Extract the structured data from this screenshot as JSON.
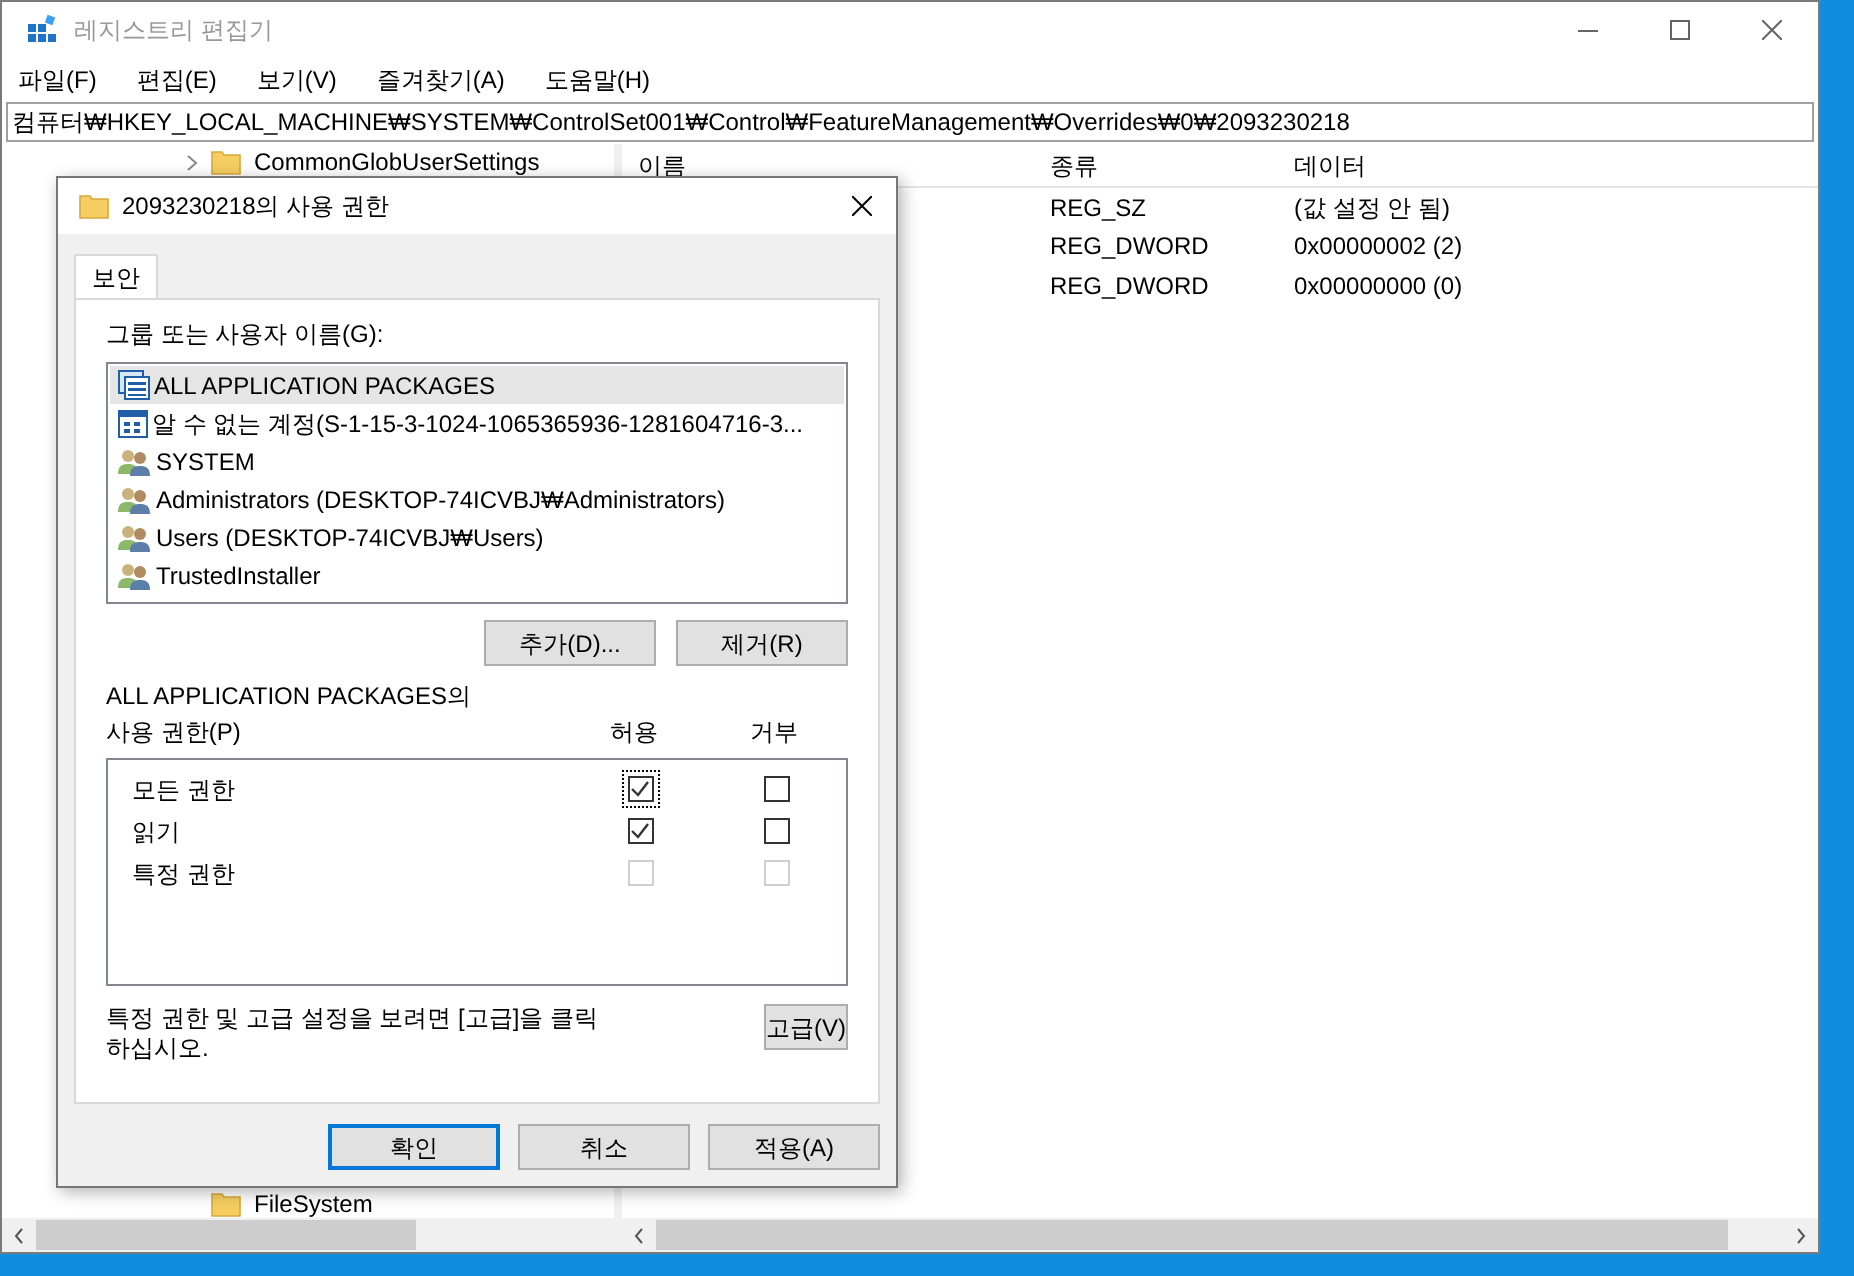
{
  "window": {
    "title": "레지스트리 편집기"
  },
  "menu": [
    "파일(F)",
    "편집(E)",
    "보기(V)",
    "즐겨찾기(A)",
    "도움말(H)"
  ],
  "address": "컴퓨터₩HKEY_LOCAL_MACHINE₩SYSTEM₩ControlSet001₩Control₩FeatureManagement₩Overrides₩0₩2093230218",
  "tree": {
    "items": [
      {
        "label": "CommonGlobUserSettings",
        "expandable": true
      },
      {
        "label": "FileSystem",
        "expandable": false
      }
    ]
  },
  "list": {
    "columns": [
      "이름",
      "종류",
      "데이터"
    ],
    "rows": [
      {
        "type": "REG_SZ",
        "data": "(값 설정 안 됨)"
      },
      {
        "type": "REG_DWORD",
        "data": "0x00000002 (2)"
      },
      {
        "type": "REG_DWORD",
        "data": "0x00000000 (0)"
      }
    ]
  },
  "dialog": {
    "title": "2093230218의 사용 권한",
    "tabs": [
      {
        "label": "보안",
        "selected": true
      }
    ],
    "principals_label": "그룹 또는 사용자 이름(G):",
    "principals": [
      {
        "kind": "package",
        "name": "ALL APPLICATION PACKAGES",
        "selected": true
      },
      {
        "kind": "account",
        "name": "알 수 없는 계정(S-1-15-3-1024-1065365936-1281604716-3...",
        "selected": false
      },
      {
        "kind": "group",
        "name": "SYSTEM",
        "selected": false
      },
      {
        "kind": "group",
        "name": "Administrators (DESKTOP-74ICVBJ₩Administrators)",
        "selected": false
      },
      {
        "kind": "group",
        "name": "Users (DESKTOP-74ICVBJ₩Users)",
        "selected": false
      },
      {
        "kind": "group",
        "name": "TrustedInstaller",
        "selected": false
      }
    ],
    "add_button": "추가(D)...",
    "remove_button": "제거(R)",
    "permissions_label_1": "ALL APPLICATION PACKAGES의",
    "permissions_label_2": "사용 권한(P)",
    "allow_header": "허용",
    "deny_header": "거부",
    "permissions": [
      {
        "name": "모든 권한",
        "allow": {
          "checked": true,
          "disabled": false,
          "focused": true
        },
        "deny": {
          "checked": false,
          "disabled": false,
          "focused": false
        }
      },
      {
        "name": "읽기",
        "allow": {
          "checked": true,
          "disabled": false,
          "focused": false
        },
        "deny": {
          "checked": false,
          "disabled": false,
          "focused": false
        }
      },
      {
        "name": "특정 권한",
        "allow": {
          "checked": false,
          "disabled": true,
          "focused": false
        },
        "deny": {
          "checked": false,
          "disabled": true,
          "focused": false
        }
      }
    ],
    "advanced_note": "특정 권한 및 고급 설정을 보려면 [고급]을 클릭하십시오.",
    "advanced_button": "고급(V)",
    "buttons": [
      {
        "label": "확인",
        "default": true
      },
      {
        "label": "취소",
        "default": false
      },
      {
        "label": "적용(A)",
        "default": false
      }
    ]
  }
}
